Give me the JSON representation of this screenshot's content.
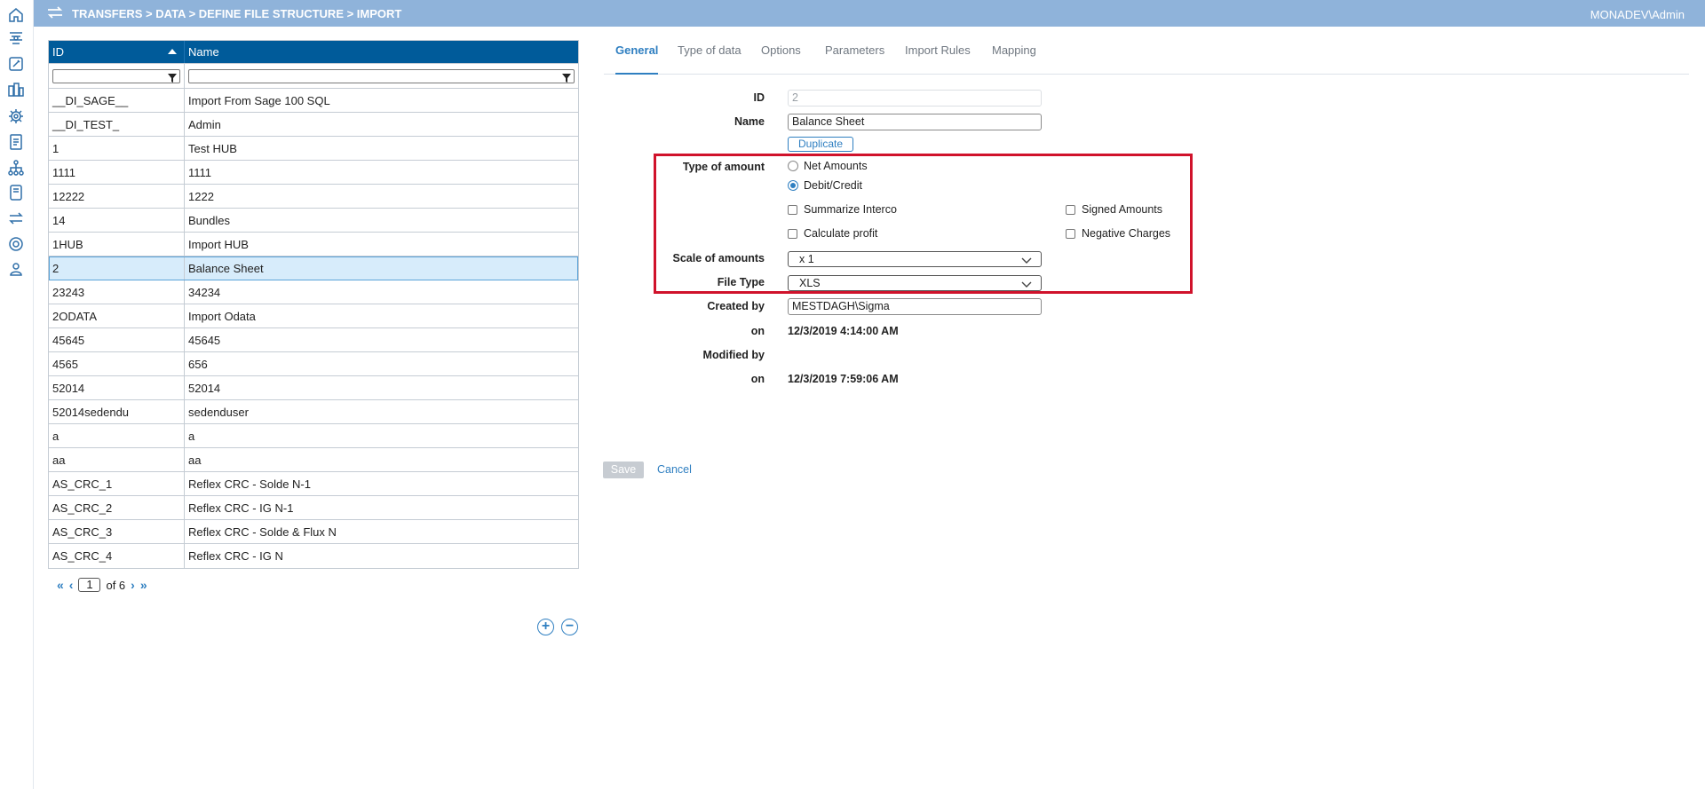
{
  "header": {
    "breadcrumb": "TRANSFERS > DATA > DEFINE FILE STRUCTURE > IMPORT",
    "user": "MONADEV\\Admin"
  },
  "sidebar": {
    "icons": [
      "home-icon",
      "layers-icon",
      "edit-icon",
      "org-chart-icon",
      "bug-icon",
      "report-icon",
      "hierarchy-icon",
      "book-icon",
      "transfer-icon",
      "settings-icon",
      "user-admin-icon"
    ]
  },
  "grid": {
    "columns": [
      "ID",
      "Name"
    ],
    "rows": [
      [
        "__DI_SAGE__",
        "Import From Sage 100 SQL"
      ],
      [
        "__DI_TEST_",
        "Admin"
      ],
      [
        "1",
        "Test HUB"
      ],
      [
        "1111",
        "1111"
      ],
      [
        "12222",
        "1222"
      ],
      [
        "14",
        "Bundles"
      ],
      [
        "1HUB",
        "Import HUB"
      ],
      [
        "2",
        "Balance Sheet"
      ],
      [
        "23243",
        "34234"
      ],
      [
        "2ODATA",
        "Import Odata"
      ],
      [
        "45645",
        "45645"
      ],
      [
        "4565",
        "656"
      ],
      [
        "52014",
        "52014"
      ],
      [
        "52014sedendu",
        "sedenduser"
      ],
      [
        "a",
        "a"
      ],
      [
        "aa",
        "aa"
      ],
      [
        "AS_CRC_1",
        "Reflex CRC - Solde N-1"
      ],
      [
        "AS_CRC_2",
        "Reflex CRC - IG N-1"
      ],
      [
        "AS_CRC_3",
        "Reflex CRC - Solde & Flux N"
      ],
      [
        "AS_CRC_4",
        "Reflex CRC - IG N"
      ]
    ],
    "selected_row_id": "2",
    "pager": {
      "first": "«",
      "prev": "‹",
      "page": "1",
      "of_text": "of 6",
      "next": "›",
      "last": "»"
    },
    "add_label": "+",
    "remove_label": "−"
  },
  "tabs": [
    "General",
    "Type of data",
    "Options",
    "Parameters",
    "Import Rules",
    "Mapping"
  ],
  "active_tab": "General",
  "form": {
    "id_label": "ID",
    "id_value": "2",
    "name_label": "Name",
    "name_value": "Balance Sheet",
    "duplicate_label": "Duplicate",
    "type_of_amount_label": "Type of amount",
    "net_amounts_label": "Net Amounts",
    "debit_credit_label": "Debit/Credit",
    "selected_type": "Debit/Credit",
    "summarize_interco_label": "Summarize Interco",
    "signed_amounts_label": "Signed Amounts",
    "calculate_profit_label": "Calculate profit",
    "negative_charges_label": "Negative Charges",
    "scale_label": "Scale of amounts",
    "scale_value": "x 1",
    "file_type_label": "File Type",
    "file_type_value": "XLS",
    "created_by_label": "Created by",
    "created_by_value": "MESTDAGH\\Sigma",
    "created_on_label": "on",
    "created_on_value": "12/3/2019 4:14:00 AM",
    "modified_by_label": "Modified by",
    "modified_on_label": "on",
    "modified_on_value": "12/3/2019 7:59:06 AM"
  },
  "actions": {
    "save_label": "Save",
    "cancel_label": "Cancel"
  },
  "colors": {
    "header_bg": "#8fb3da",
    "grid_header_bg": "#005b9a",
    "accent": "#2f7fc1",
    "highlight_border": "#d0122b",
    "selected_row_bg": "#d7ecfb"
  }
}
